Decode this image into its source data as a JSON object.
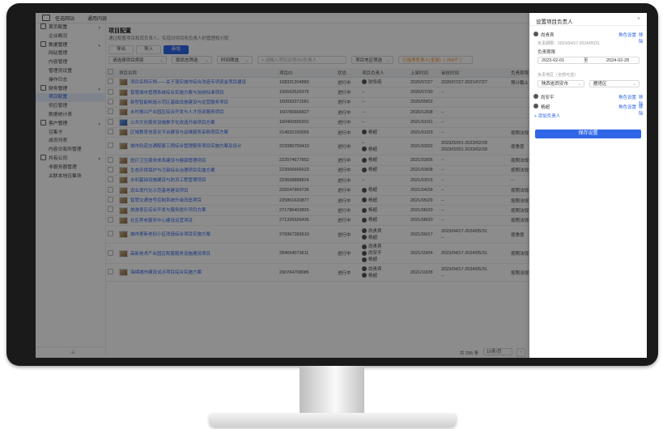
{
  "topbar": {
    "brand": "任选网站",
    "nav": "通用内容"
  },
  "sidebar": {
    "items": [
      {
        "label": "首页配置",
        "group": true,
        "chev": "▴"
      },
      {
        "label": "企业概况",
        "group": false
      },
      {
        "label": "数据管理",
        "group": true,
        "chev": "▴"
      },
      {
        "label": "网站管理",
        "group": false
      },
      {
        "label": "内容管理",
        "group": false
      },
      {
        "label": "管理员设置",
        "group": false
      },
      {
        "label": "操作日志",
        "group": false
      },
      {
        "label": "财务管理",
        "group": true,
        "chev": "▴"
      },
      {
        "label": "项目配置",
        "group": false,
        "active": true
      },
      {
        "label": "供应管理",
        "group": false
      },
      {
        "label": "数据统计表",
        "group": false
      },
      {
        "label": "客户管理",
        "group": true,
        "chev": "▴"
      },
      {
        "label": "召集令",
        "group": false
      },
      {
        "label": "成员列表",
        "group": false
      },
      {
        "label": "内容交易所管理",
        "group": false
      },
      {
        "label": "共有公司",
        "group": true,
        "chev": "▴"
      },
      {
        "label": "非服务器管理",
        "group": false
      },
      {
        "label": "关联本地召集场",
        "group": false
      }
    ],
    "footer": "☰"
  },
  "main": {
    "title": "项目配置",
    "subtitle": "通过配置项目和其负责人，实现对项目和负责人的管理和分配",
    "buttons": [
      "导出",
      "导入",
      "新增"
    ],
    "filters": {
      "sel1": "请选择项目类别",
      "sel2": "按状态筛选",
      "sel3": "时间筛选",
      "search_placeholder": "请输入项目名称/ID/负责人",
      "sel4": "项目地区筛选",
      "tag": "已选项负责人(全部)（ 259个 ）"
    },
    "columns": [
      "",
      "项目名称",
      "项目ID",
      "状态",
      "项目负责人",
      "上架时间",
      "审核时间",
      "负责期限"
    ],
    "rows": [
      {
        "name": "项目名称示例——关于落实城市综合改造专项资金项目建设",
        "id": "168331204883",
        "status": "进行中",
        "owner": "财务组",
        "owner2": "",
        "date": "2020/07/27",
        "period": "2020/07/27-2021/07/27",
        "period2": "",
        "term": "预计截止",
        "thumb": "",
        "tall": false
      },
      {
        "name": "智慧城市管理系统综合实施方案与验收标准项目",
        "id": "156562526375",
        "status": "进行中",
        "owner": "--",
        "owner2": "",
        "date": "2020/07/30",
        "period": "--",
        "period2": "",
        "term": "",
        "thumb": "",
        "tall": false
      },
      {
        "name": "新型智能制造示范区基础设施建设与运营服务项目",
        "id": "160093371581",
        "status": "进行中",
        "owner": "--",
        "owner2": "",
        "date": "2020/09/02",
        "period": "",
        "period2": "",
        "term": "",
        "thumb": "",
        "tall": false
      },
      {
        "name": "乡村振兴产业园区综合开发与人才培训服务项目",
        "id": "160780666827",
        "status": "进行中",
        "owner": "--",
        "owner2": "",
        "date": "2020/12/08",
        "period": "--",
        "period2": "",
        "term": "",
        "thumb": "",
        "tall": false
      },
      {
        "name": "公共文化服务设施数字化改造升级项目方案",
        "id": "160400555301",
        "status": "进行中",
        "owner": "--",
        "owner2": "",
        "date": "2021/01/01",
        "period": "--",
        "period2": "",
        "term": "",
        "thumb": "blue",
        "tall": false
      },
      {
        "name": "区域教育信息化平台建设与运维服务采购项目方案",
        "id": "214032150065",
        "status": "进行中",
        "owner": "杨超",
        "owner2": "",
        "date": "2021/01/03",
        "period": "--",
        "period2": "",
        "term": "按照法规",
        "thumb": "",
        "tall": false
      },
      {
        "name": "城市轨道交通配套工程综合管理服务项目实施方案及设计",
        "id": "222080750410",
        "status": "进行中",
        "owner": "--",
        "owner2": "杨超",
        "date": "2021/03/02",
        "period": "2023/02/01-2023/02/28",
        "period2": "2023/02/01-2023/02/28",
        "term": "按季度",
        "thumb": "",
        "tall": true
      },
      {
        "name": "医疗卫生服务体系建设与健康管理项目",
        "id": "222074677852",
        "status": "进行中",
        "owner": "杨超",
        "owner2": "",
        "date": "2021/03/06",
        "period": "--",
        "period2": "",
        "term": "按照法规",
        "thumb": "",
        "tall": false
      },
      {
        "name": "生态环境保护与污染综合治理项目实施方案",
        "id": "223066666623",
        "status": "进行中",
        "owner": "杨超",
        "owner2": "",
        "date": "2021/03/08",
        "period": "--",
        "period2": "",
        "term": "按照法规",
        "thumb": "",
        "tall": false
      },
      {
        "name": "水利基础设施建设与防洪工程管理项目",
        "id": "223668888824",
        "status": "进行中",
        "owner": "--",
        "owner2": "",
        "date": "2021/03/15",
        "period": "--",
        "period2": "",
        "term": "--",
        "thumb": "",
        "tall": false
      },
      {
        "name": "农业现代化示范基地建设项目",
        "id": "225647969736",
        "status": "进行中",
        "owner": "杨超",
        "owner2": "",
        "date": "2021/04/28",
        "period": "--",
        "period2": "",
        "term": "按照法规",
        "thumb": "",
        "tall": false
      },
      {
        "name": "智慧交通信号控制系统升级改造项目",
        "id": "225861620877",
        "status": "进行中",
        "owner": "杨超",
        "owner2": "",
        "date": "2021/05/29",
        "period": "--",
        "period2": "",
        "term": "按照法规",
        "thumb": "",
        "tall": false
      },
      {
        "name": "旅游景区综合开发与服务提升项目方案",
        "id": "271786403826",
        "status": "进行中",
        "owner": "杨超",
        "owner2": "",
        "date": "2021/06/20",
        "period": "--",
        "period2": "",
        "term": "按照法规",
        "thumb": "",
        "tall": false
      },
      {
        "name": "社区养老服务中心建设运营项目",
        "id": "271326926436",
        "status": "进行中",
        "owner": "杨超",
        "owner2": "",
        "date": "2021/08/20",
        "period": "--",
        "period2": "",
        "term": "按照法规",
        "thumb": "",
        "tall": false
      },
      {
        "name": "城市更新老旧小区改造综合项目实施方案",
        "id": "279367283610",
        "status": "进行中",
        "owner": "尚贵宾",
        "owner2": "杨超",
        "date": "2021/09/17",
        "period": "2023/04/17-2024/05/31",
        "period2": "--",
        "term": "按季度",
        "thumb": "",
        "tall": true
      },
      {
        "name": "高新技术产业园区配套服务设施建设项目",
        "id": "284654073611",
        "status": "进行中",
        "owner": "尚贵宾",
        "owner2": "尚安平",
        "date": "2021/10/04",
        "period": "2023/04/17-2024/05/31",
        "period2": "",
        "term": "按照法规",
        "thumb": "",
        "tall": true,
        "owner3": "杨超"
      },
      {
        "name": "海绵城市建设试点项目综合实施方案",
        "id": "290764708085",
        "status": "进行中",
        "owner": "尚贵宾",
        "owner2": "杨超",
        "date": "2021/10/28",
        "period": "2023/04/17-2024/05/31",
        "period2": "--",
        "term": "按照法规",
        "thumb": "",
        "tall": true
      }
    ],
    "pager": {
      "total": "共 295 条",
      "size": "10条/页",
      "page": "1",
      "prev": "‹"
    }
  },
  "drawer": {
    "title": "设置项目负责人",
    "close": "×",
    "person1": {
      "name": "尚贵宾",
      "a1": "角色设置",
      "a2": "移除"
    },
    "hint1": "负责期限：2023/04/17-2024/05/31",
    "label_range": "负责期限",
    "date_start": "2023-02-01",
    "date_sep": "至",
    "date_end": "2024-02-28",
    "hint2": "负责地区（全部可选）",
    "region1": "陕西省西安市",
    "region2": "雁塔区",
    "person2": {
      "name": "尚安平",
      "a1": "角色设置",
      "a2": "移除"
    },
    "person3": {
      "name": "杨超",
      "a1": "角色设置",
      "a2": "移除"
    },
    "add": "+ 添加负责人",
    "save": "保存设置"
  }
}
